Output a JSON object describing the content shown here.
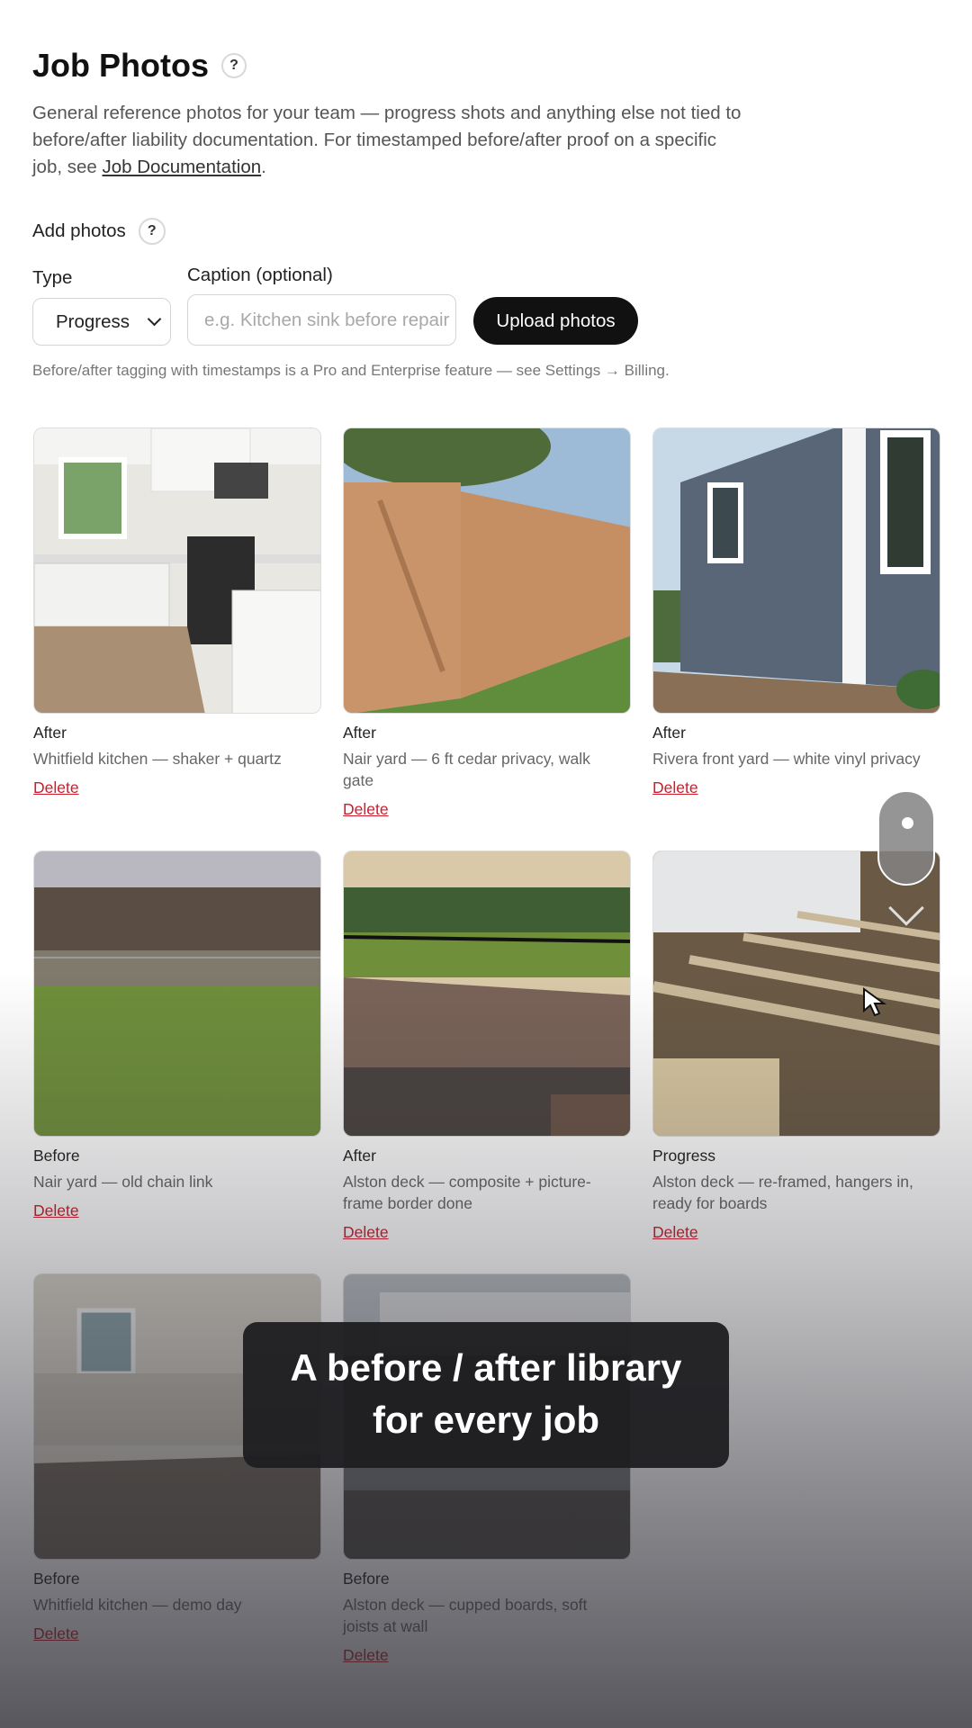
{
  "header": {
    "title": "Job Photos",
    "help_glyph": "?",
    "intro_text": "General reference photos for your team — progress shots and anything else not tied to before/after liability documentation. For timestamped before/after proof on a specific job, see ",
    "intro_link": "Job Documentation",
    "intro_end": "."
  },
  "add_photos": {
    "label": "Add photos",
    "help_glyph": "?",
    "type_label": "Type",
    "type_value": "Progress",
    "caption_label": "Caption (optional)",
    "caption_placeholder": "e.g. Kitchen sink before repair",
    "upload_label": "Upload photos",
    "note": "Before/after tagging with timestamps is a Pro and Enterprise feature — see Settings → Billing."
  },
  "photos": [
    {
      "tag": "After",
      "caption": "Whitfield kitchen — shaker + quartz",
      "delete": "Delete",
      "scene": "kitchen"
    },
    {
      "tag": "After",
      "caption": "Nair yard — 6 ft cedar privacy, walk gate",
      "delete": "Delete",
      "scene": "cedar-fence"
    },
    {
      "tag": "After",
      "caption": "Rivera front yard — white vinyl privacy",
      "delete": "Delete",
      "scene": "siding"
    },
    {
      "tag": "Before",
      "caption": "Nair yard — old chain link",
      "delete": "Delete",
      "scene": "chain-link"
    },
    {
      "tag": "After",
      "caption": "Alston deck — composite + picture-frame border done",
      "delete": "Delete",
      "scene": "deck"
    },
    {
      "tag": "Progress",
      "caption": "Alston deck — re-framed, hangers in, ready for boards",
      "delete": "Delete",
      "scene": "deck-frame"
    },
    {
      "tag": "Before",
      "caption": "Whitfield kitchen — demo day",
      "delete": "Delete",
      "scene": "demo"
    },
    {
      "tag": "Before",
      "caption": "Alston deck — cupped boards, soft joists at wall",
      "delete": "Delete",
      "scene": "old-deck"
    }
  ],
  "overlay": {
    "line1": "A before / after library",
    "line2": "for every job"
  }
}
